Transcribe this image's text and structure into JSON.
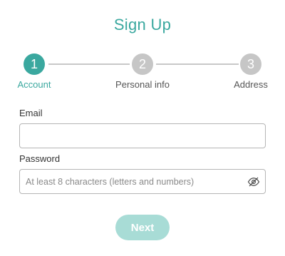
{
  "form": {
    "title": "Sign Up",
    "steps": [
      {
        "number": "1",
        "label": "Account",
        "state": "active"
      },
      {
        "number": "2",
        "label": "Personal info",
        "state": "inactive"
      },
      {
        "number": "3",
        "label": "Address",
        "state": "inactive"
      }
    ],
    "email": {
      "label": "Email",
      "value": "",
      "placeholder": ""
    },
    "password": {
      "label": "Password",
      "value": "",
      "placeholder": "At least 8 characters (letters and numbers)",
      "toggle_icon": "eye-icon"
    },
    "next_label": "Next",
    "next_state": "disabled"
  },
  "colors": {
    "accent": "#3aa89f",
    "inactive_step": "#c6c6c6",
    "button_disabled": "#a8dcd6",
    "border": "#b5b5b5"
  }
}
